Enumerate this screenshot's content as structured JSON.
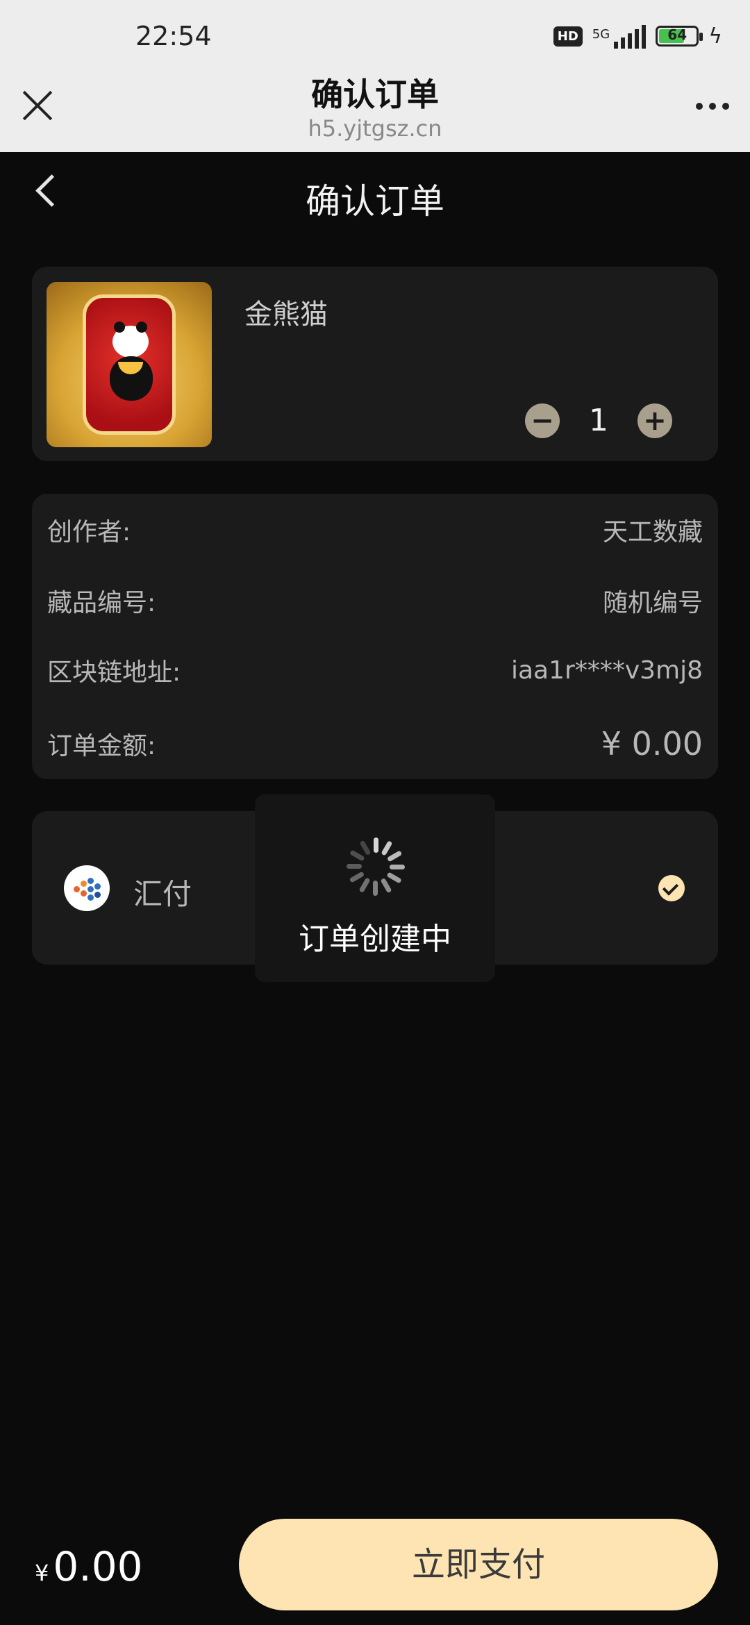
{
  "status_bar": {
    "time": "22:54",
    "hd": "HD",
    "network": "5G",
    "battery": "64"
  },
  "browser": {
    "title": "确认订单",
    "url": "h5.yjtgsz.cn"
  },
  "page": {
    "title": "确认订单"
  },
  "product": {
    "name": "金熊猫",
    "quantity": "1",
    "minus": "−",
    "plus": "+"
  },
  "info": {
    "creator_label": "创作者:",
    "creator_value": "天工数藏",
    "serial_label": "藏品编号:",
    "serial_value": "随机编号",
    "chain_label": "区块链地址:",
    "chain_value": "iaa1r****v3mj8",
    "amount_label": "订单金额:",
    "amount_value": "¥ 0.00"
  },
  "payment": {
    "method": "汇付",
    "selected": true
  },
  "toast": {
    "text": "订单创建中"
  },
  "footer": {
    "currency": "¥",
    "total": "0.00",
    "pay_button": "立即支付"
  },
  "colors": {
    "accent": "#fde4b2",
    "background": "#0b0b0b",
    "card": "#1b1b1b"
  }
}
